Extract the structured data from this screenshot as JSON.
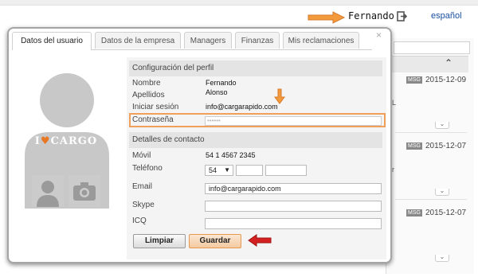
{
  "topbar": {
    "user_name": "Fernando",
    "language_link": "español"
  },
  "background": {
    "dates": [
      "2015-12-09",
      "2015-12-07",
      "2015-12-07"
    ],
    "badge": "MSG"
  },
  "modal": {
    "tabs": [
      {
        "label": "Datos del usuario",
        "active": true
      },
      {
        "label": "Datos de la empresa",
        "active": false
      },
      {
        "label": "Managers",
        "active": false
      },
      {
        "label": "Finanzas",
        "active": false
      },
      {
        "label": "Mis reclamaciones",
        "active": false
      }
    ],
    "close_symbol": "×",
    "brand": {
      "prefix": "I",
      "suffix": "CARGO",
      "heart": "♥"
    }
  },
  "profile": {
    "section_title": "Configuración del perfil",
    "nombre_label": "Nombre",
    "nombre_value": "Fernando",
    "apellidos_label": "Apellidos",
    "apellidos_value": "Alonso",
    "login_label": "Iniciar sesión",
    "login_value": "info@cargarapido.com",
    "password_label": "Contraseña",
    "password_value": "••••••"
  },
  "contact": {
    "section_title": "Detalles de contacto",
    "movil_label": "Móvil",
    "movil_value": "54 1 4567 2345",
    "telefono_label": "Teléfono",
    "telefono_code": "54",
    "email_label": "Email",
    "email_value": "info@cargarapido.com",
    "skype_label": "Skype",
    "icq_label": "ICQ"
  },
  "buttons": {
    "clear": "Limpiar",
    "save": "Guardar"
  },
  "colors": {
    "highlight": "#f0a05a",
    "arrow_orange": "#f0a05a",
    "arrow_red": "#d42020",
    "link": "#1a4fa0"
  }
}
